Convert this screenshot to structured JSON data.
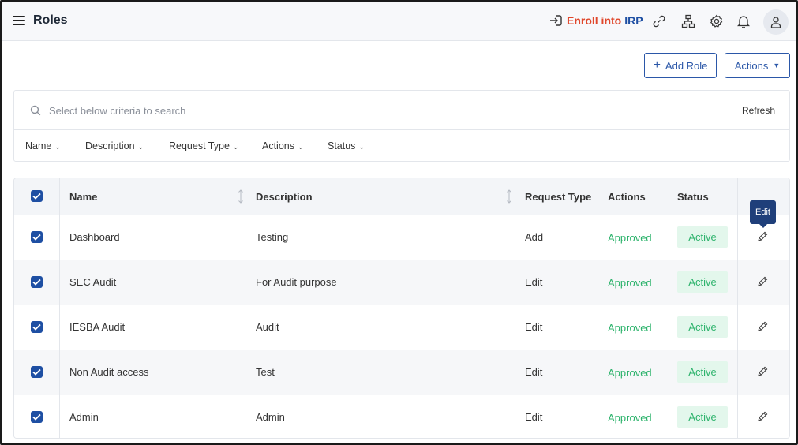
{
  "header": {
    "title": "Roles",
    "enroll_text": "Enroll into",
    "enroll_accent": "IRP"
  },
  "toolbar": {
    "add_role_label": "Add Role",
    "actions_label": "Actions"
  },
  "search": {
    "placeholder": "Select below criteria to search",
    "value": "",
    "refresh_label": "Refresh"
  },
  "filters": [
    "Name",
    "Description",
    "Request Type",
    "Actions",
    "Status"
  ],
  "table": {
    "columns": {
      "name": "Name",
      "description": "Description",
      "request_type": "Request Type",
      "actions": "Actions",
      "status": "Status"
    },
    "rows": [
      {
        "name": "Dashboard",
        "description": "Testing",
        "request_type": "Add",
        "action": "Approved",
        "status": "Active"
      },
      {
        "name": "SEC Audit",
        "description": "For Audit purpose",
        "request_type": "Edit",
        "action": "Approved",
        "status": "Active"
      },
      {
        "name": "IESBA Audit",
        "description": "Audit",
        "request_type": "Edit",
        "action": "Approved",
        "status": "Active"
      },
      {
        "name": "Non Audit access",
        "description": "Test",
        "request_type": "Edit",
        "action": "Approved",
        "status": "Active"
      },
      {
        "name": "Admin",
        "description": "Admin",
        "request_type": "Edit",
        "action": "Approved",
        "status": "Active"
      }
    ],
    "edit_tooltip": "Edit"
  },
  "colors": {
    "primary": "#1e4fa3",
    "enroll": "#e0472b",
    "approved": "#2db36c",
    "active_bg": "#e3f7ec",
    "tooltip_bg": "#1f3f7a"
  },
  "icons": {
    "menu": "menu-icon",
    "enroll": "enroll-icon",
    "link": "link-icon",
    "hierarchy": "hierarchy-icon",
    "settings": "gear-icon",
    "notifications": "bell-icon",
    "user": "user-icon",
    "search": "search-icon",
    "edit": "pencil-icon"
  }
}
